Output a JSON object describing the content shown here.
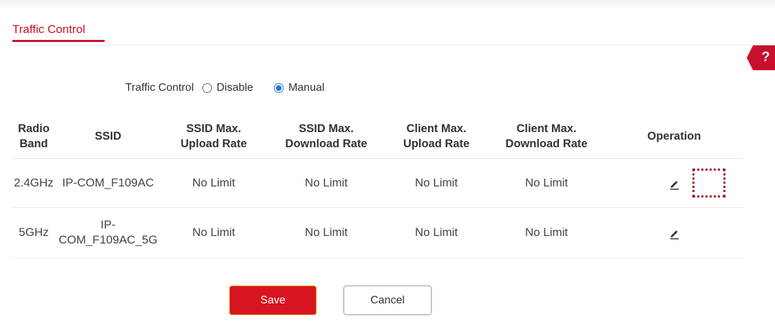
{
  "tab": {
    "title": "Traffic Control"
  },
  "help": {
    "symbol": "?"
  },
  "traffic_control": {
    "label": "Traffic Control",
    "options": [
      {
        "label": "Disable",
        "checked": false
      },
      {
        "label": "Manual",
        "checked": true
      }
    ]
  },
  "table": {
    "headers": [
      [
        "Radio",
        "Band"
      ],
      [
        "SSID"
      ],
      [
        "SSID Max.",
        "Upload Rate"
      ],
      [
        "SSID Max.",
        "Download Rate"
      ],
      [
        "Client Max.",
        "Upload Rate"
      ],
      [
        "Client Max.",
        "Download Rate"
      ],
      [
        "Operation"
      ]
    ],
    "rows": [
      {
        "band": "2.4GHz",
        "ssid": [
          "IP-COM_F109AC"
        ],
        "ssid_up": "No Limit",
        "ssid_down": "No Limit",
        "client_up": "No Limit",
        "client_down": "No Limit",
        "operation_icon": "edit-icon"
      },
      {
        "band": "5GHz",
        "ssid": [
          "IP-",
          "COM_F109AC_5G"
        ],
        "ssid_up": "No Limit",
        "ssid_down": "No Limit",
        "client_up": "No Limit",
        "client_down": "No Limit",
        "operation_icon": "edit-icon"
      }
    ]
  },
  "buttons": {
    "save": "Save",
    "cancel": "Cancel"
  },
  "colors": {
    "accent": "#c8102e",
    "save_bg": "#d7141f",
    "radio_checked": "#1a73e8",
    "highlight": "#a0141e"
  }
}
